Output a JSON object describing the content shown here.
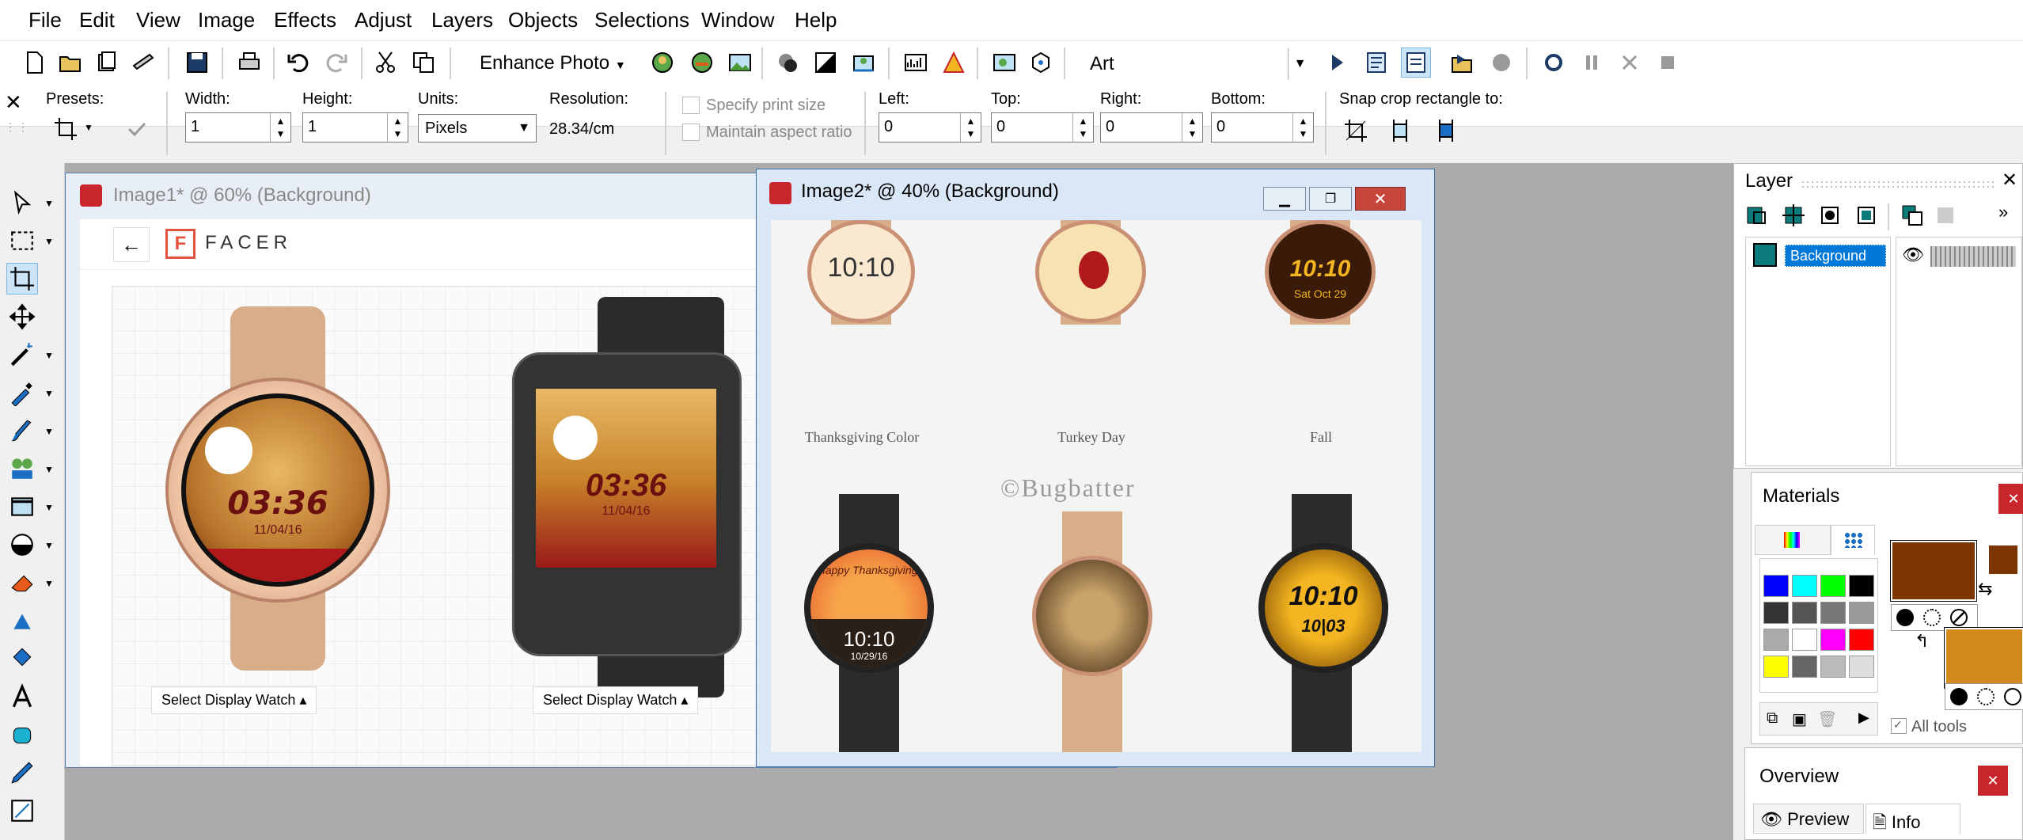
{
  "menu": [
    "File",
    "Edit",
    "View",
    "Image",
    "Effects",
    "Adjust",
    "Layers",
    "Objects",
    "Selections",
    "Window",
    "Help"
  ],
  "toolbar": {
    "enhance_label": "Enhance Photo",
    "workspace_value": "Art"
  },
  "crop_options": {
    "presets_label": "Presets:",
    "width_label": "Width:",
    "width_value": "1",
    "height_label": "Height:",
    "height_value": "1",
    "units_label": "Units:",
    "units_value": "Pixels",
    "resolution_label": "Resolution:",
    "resolution_value": "28.34/cm",
    "specify_print_size": "Specify print size",
    "maintain_aspect": "Maintain aspect ratio",
    "left_label": "Left:",
    "left_value": "0",
    "top_label": "Top:",
    "top_value": "0",
    "right_label": "Right:",
    "right_value": "0",
    "bottom_label": "Bottom:",
    "bottom_value": "0",
    "snap_label": "Snap crop rectangle to:"
  },
  "image1": {
    "title": "Image1* @  60% (Background)",
    "brand": "FACER",
    "watch1_time": "03:36",
    "watch1_date": "11/04/16",
    "watch2_time": "03:36",
    "watch2_date": "11/04/16",
    "select_btn_1": "Select Display Watch ▴",
    "select_btn_2": "Select Display Watch ▴"
  },
  "image2": {
    "title": "Image2* @  40% (Background)",
    "watermark": "©Bugbatter",
    "faces": [
      {
        "time": "10:10",
        "caption": "Thanksgiving Color"
      },
      {
        "time": "",
        "caption": "Turkey Day"
      },
      {
        "time": "10:10",
        "caption": "Fall",
        "sub": "Sat Oct 29"
      },
      {
        "time": "10:10",
        "caption": "",
        "sub": "10/29/16",
        "greeting": "Happy Thanksgiving!"
      },
      {
        "time": "",
        "caption": ""
      },
      {
        "time": "10:10",
        "caption": "",
        "sub": "10|03"
      }
    ]
  },
  "layer_panel": {
    "title": "Layer",
    "layer_name": "Background"
  },
  "materials": {
    "title": "Materials",
    "all_tools": "All tools",
    "fg_color": "#7a3500",
    "bg_color": "#d4891c",
    "swatches": [
      "#0000ff",
      "#00ffff",
      "#00ff00",
      "#000000",
      "#333333",
      "#555555",
      "#777777",
      "#999999",
      "#aaaaaa",
      "#ffffff",
      "#ff00ff",
      "#ff0000",
      "#ffff00",
      "#666666",
      "#bbbbbb",
      "#dddddd"
    ]
  },
  "overview": {
    "title": "Overview",
    "tab_preview": "Preview",
    "tab_info": "Info"
  },
  "colors": {
    "accent": "#0078d7",
    "window_active": "#d9e7f7",
    "window_inactive": "#e8eef5",
    "close_red": "#c8262c"
  }
}
